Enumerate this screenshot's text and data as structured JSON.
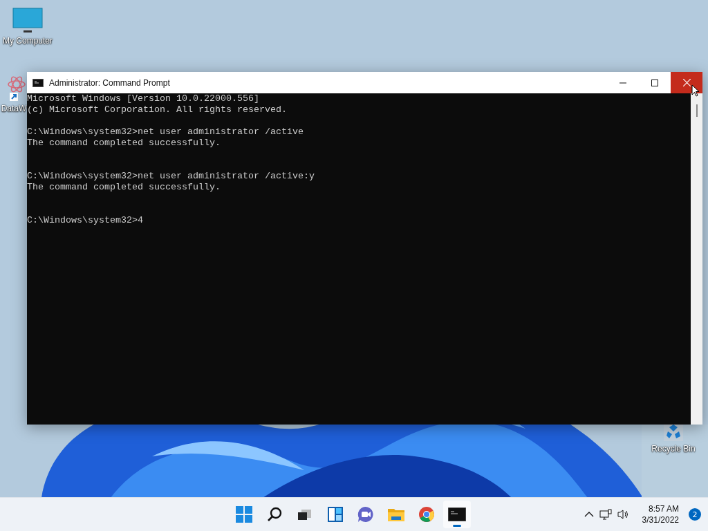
{
  "desktop_icons": [
    {
      "label": "My Computer",
      "kind": "computer"
    },
    {
      "label": "DataW",
      "kind": "shortcut"
    },
    {
      "label": "Recycle Bin",
      "kind": "recycle"
    }
  ],
  "window": {
    "title": "Administrator: Command Prompt",
    "caption_buttons": [
      {
        "kind": "minimize",
        "hovered": false
      },
      {
        "kind": "maximize",
        "hovered": false
      },
      {
        "kind": "close",
        "hovered": true
      }
    ],
    "console": {
      "blocks": [
        [
          "Microsoft Windows [Version 10.0.22000.556]",
          "(c) Microsoft Corporation. All rights reserved."
        ],
        [
          "C:\\Windows\\system32>net user administrator /active",
          "The command completed successfully."
        ],
        [
          "C:\\Windows\\system32>net user administrator /active:y",
          "The command completed successfully."
        ],
        [
          "C:\\Windows\\system32>4"
        ]
      ]
    }
  },
  "taskbar": {
    "apps": [
      {
        "kind": "start",
        "selected": false
      },
      {
        "kind": "search",
        "selected": false
      },
      {
        "kind": "taskview",
        "selected": false
      },
      {
        "kind": "widgets",
        "selected": false
      },
      {
        "kind": "chat",
        "selected": false
      },
      {
        "kind": "explorer",
        "selected": false
      },
      {
        "kind": "browser",
        "selected": false
      },
      {
        "kind": "terminal",
        "selected": true
      }
    ],
    "clock": {
      "time": "8:57 AM",
      "date": "3/31/2022"
    },
    "notifications": "2"
  }
}
